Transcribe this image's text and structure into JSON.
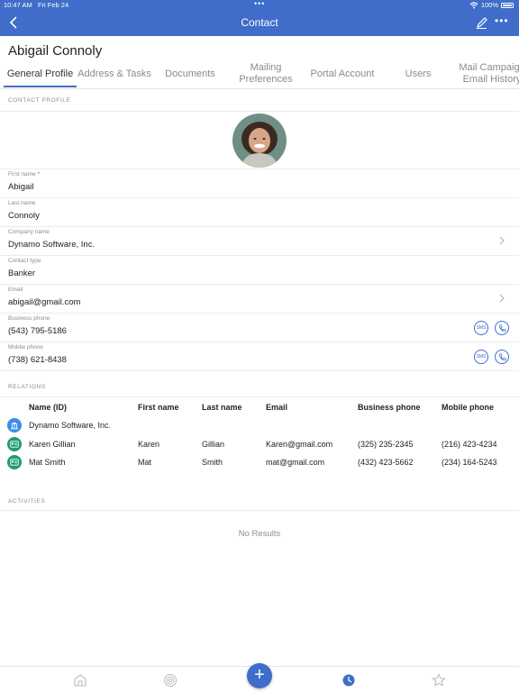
{
  "status_bar": {
    "time": "10:47 AM",
    "date": "Fri Feb 24",
    "battery": "100%"
  },
  "nav": {
    "title": "Contact"
  },
  "contact_name": "Abigail Connoly",
  "tabs": [
    {
      "label": "General Profile",
      "active": true
    },
    {
      "label": "Address & Tasks"
    },
    {
      "label": "Documents"
    },
    {
      "label": "Mailing Preferences"
    },
    {
      "label": "Portal Account"
    },
    {
      "label": "Users"
    },
    {
      "label": "Mail Campaign Email History"
    }
  ],
  "contact_profile": {
    "section_label": "CONTACT PROFILE",
    "fields": [
      {
        "label": "First name",
        "required_mark": "*",
        "value": "Abigail"
      },
      {
        "label": "Last name",
        "value": "Connoly"
      },
      {
        "label": "Company name",
        "value": "Dynamo Software, Inc."
      },
      {
        "label": "Contact type",
        "value": "Banker"
      },
      {
        "label": "Email",
        "value": "abigail@gmail.com"
      },
      {
        "label": "Business phone",
        "value": "(543) 795-5186"
      },
      {
        "label": "Mobile phone",
        "value": "(738) 621-8438"
      }
    ],
    "sms_label": "SMS"
  },
  "relations": {
    "section_label": "RELATIONS",
    "columns": [
      "Name (ID)",
      "First name",
      "Last name",
      "Email",
      "Business phone",
      "Mobile phone"
    ],
    "rows": [
      {
        "icon": "building-icon",
        "name": "Dynamo Software, Inc.",
        "first": "",
        "last": "",
        "email": "",
        "business": "",
        "mobile": ""
      },
      {
        "icon": "contact-card-icon",
        "name": "Karen Gillian",
        "first": "Karen",
        "last": "Gillian",
        "email": "Karen@gmail.com",
        "business": "(325) 235-2345",
        "mobile": "(216) 423-4234"
      },
      {
        "icon": "contact-card-icon",
        "name": "Mat Smith",
        "first": "Mat",
        "last": "Smith",
        "email": "mat@gmail.com",
        "business": "(432) 423-5662",
        "mobile": "(234) 164-5243"
      }
    ]
  },
  "activities": {
    "section_label": "ACTIVITIES",
    "empty_text": "No Results"
  },
  "tab_bar": {
    "items": [
      "home-icon",
      "target-icon",
      "add-icon",
      "recent-clock-icon",
      "star-icon"
    ],
    "fab_label": "+"
  },
  "colors": {
    "accent": "#3f6dc9",
    "company_icon": "#3a8ee6",
    "contact_icon": "#1f9d6c"
  }
}
